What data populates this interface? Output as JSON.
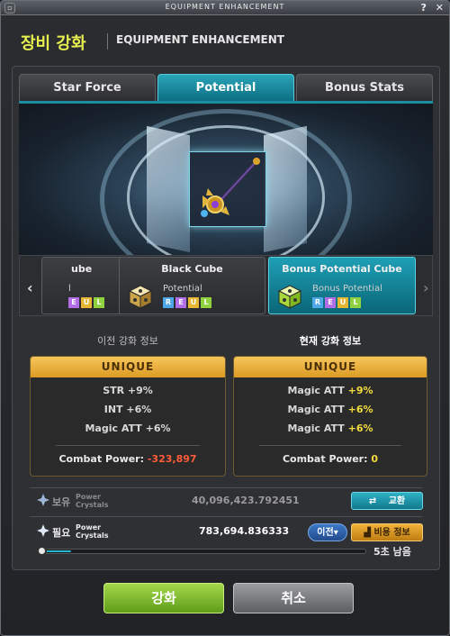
{
  "window": {
    "title": "EQUIPMENT ENHANCEMENT",
    "help_label": "?",
    "close_label": "✕"
  },
  "header": {
    "kr_title": "장비 강화",
    "en_title": "EQUIPMENT ENHANCEMENT"
  },
  "tabs": [
    {
      "label": "Star Force",
      "active": false
    },
    {
      "label": "Potential",
      "active": true
    },
    {
      "label": "Bonus Stats",
      "active": false
    }
  ],
  "cubes": {
    "partial": {
      "name": "ube",
      "type": "l",
      "grades": [
        "E",
        "U",
        "L"
      ]
    },
    "black": {
      "name": "Black Cube",
      "type": "Potential",
      "grades": [
        "R",
        "E",
        "U",
        "L"
      ]
    },
    "bonus": {
      "name": "Bonus Potential Cube",
      "type": "Bonus Potential",
      "grades": [
        "R",
        "E",
        "U",
        "L"
      ]
    },
    "prev_arrow": "‹",
    "next_arrow": "›"
  },
  "info": {
    "before": {
      "heading": "이전 강화 정보",
      "grade": "UNIQUE",
      "stats": [
        "STR +9%",
        "INT +6%",
        "Magic ATT +6%"
      ],
      "combat_label": "Combat Power:",
      "combat_value": "-323,897"
    },
    "after": {
      "heading": "현재 강화 정보",
      "grade": "UNIQUE",
      "stats": [
        {
          "name": "Magic ATT",
          "value": "+9%"
        },
        {
          "name": "Magic ATT",
          "value": "+6%"
        },
        {
          "name": "Magic ATT",
          "value": "+6%"
        }
      ],
      "combat_label": "Combat Power:",
      "combat_value": "0"
    }
  },
  "currency": {
    "owned": {
      "label": "보유",
      "sub1": "Power",
      "sub2": "Crystals",
      "value": "40,096,423.792451",
      "button": "교환"
    },
    "required": {
      "label": "필요",
      "sub1": "Power",
      "sub2": "Crystals",
      "value": "783,694.836333",
      "prev_button": "이전",
      "cost_button": "비용 정보"
    }
  },
  "timer": {
    "text": "5초 남음",
    "progress": 0.1
  },
  "buttons": {
    "enhance": "강화",
    "cancel": "취소"
  },
  "colors": {
    "accent": "#1e9fb5",
    "grade_banner": "#e8ae3c",
    "negative": "#ff5c3a",
    "positive": "#f2dc3e",
    "title_yellow": "#e8f050"
  }
}
